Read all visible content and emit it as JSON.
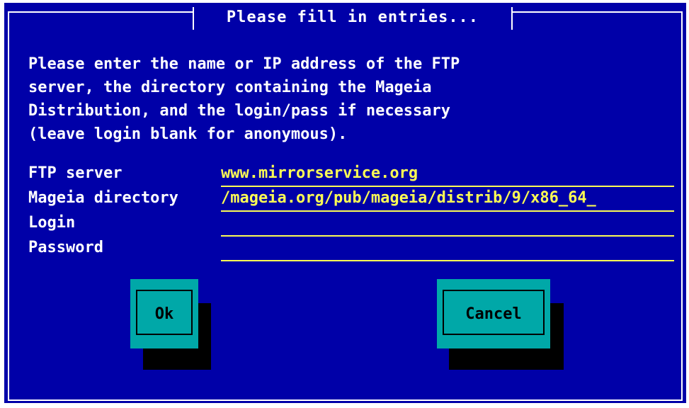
{
  "dialog": {
    "title": "Please fill in entries...",
    "message": "Please enter the name or IP address of the FTP\nserver, the directory containing the Mageia\nDistribution, and the login/pass if necessary\n(leave login blank for anonymous).",
    "fields": [
      {
        "label": "FTP server",
        "value": "www.mirrorservice.org"
      },
      {
        "label": "Mageia directory",
        "value": "/mageia.org/pub/mageia/distrib/9/x86_64_"
      },
      {
        "label": "Login",
        "value": ""
      },
      {
        "label": "Password",
        "value": ""
      }
    ],
    "buttons": {
      "ok": "Ok",
      "cancel": "Cancel"
    }
  },
  "colors": {
    "background": "#0000a8",
    "text": "#ffffff",
    "field_text": "#fcfc54",
    "button": "#00a8a8",
    "button_shadow": "#000000"
  }
}
